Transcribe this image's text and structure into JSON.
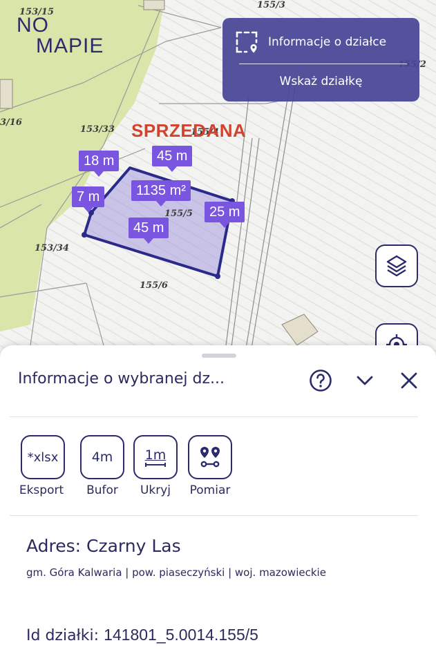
{
  "map": {
    "logo": {
      "line1": "NO",
      "line2": "MAPIE"
    },
    "status_label": "SPRZEDANA",
    "parcel_labels": [
      "153/15",
      "155/3",
      "155/2",
      "3/16",
      "153/33",
      "155/4",
      "155/5",
      "153/34",
      "155/6"
    ],
    "measurements": {
      "top": "18 m",
      "top_right": "45 m",
      "area": "1135 m²",
      "left": "7 m",
      "right": "25 m",
      "bottom": "45 m"
    },
    "info_panel": {
      "title": "Informacje o działce",
      "action": "Wskaż działkę"
    },
    "buttons": {
      "layers": "layers-icon",
      "locate": "locate-icon"
    },
    "colors": {
      "accent": "#2b2a6b",
      "measure": "#7a55e0",
      "sold": "#d2432f",
      "field": "#d8e4a8"
    }
  },
  "sheet": {
    "title": "Informacje o wybranej dz...",
    "tools": [
      {
        "icon": "*xlsx",
        "label": "Eksport"
      },
      {
        "icon": "4m",
        "label": "Bufor"
      },
      {
        "icon": "1m",
        "label": "Ukryj"
      },
      {
        "icon": "pins-icon",
        "label": "Pomiar"
      }
    ],
    "address": "Adres: Czarny Las",
    "sub_address": "gm. Góra Kalwaria | pow. piaseczyński | woj. mazowieckie",
    "plot_id_label": "Id działki:",
    "plot_id_value": "141801_5.0014.155/5"
  }
}
